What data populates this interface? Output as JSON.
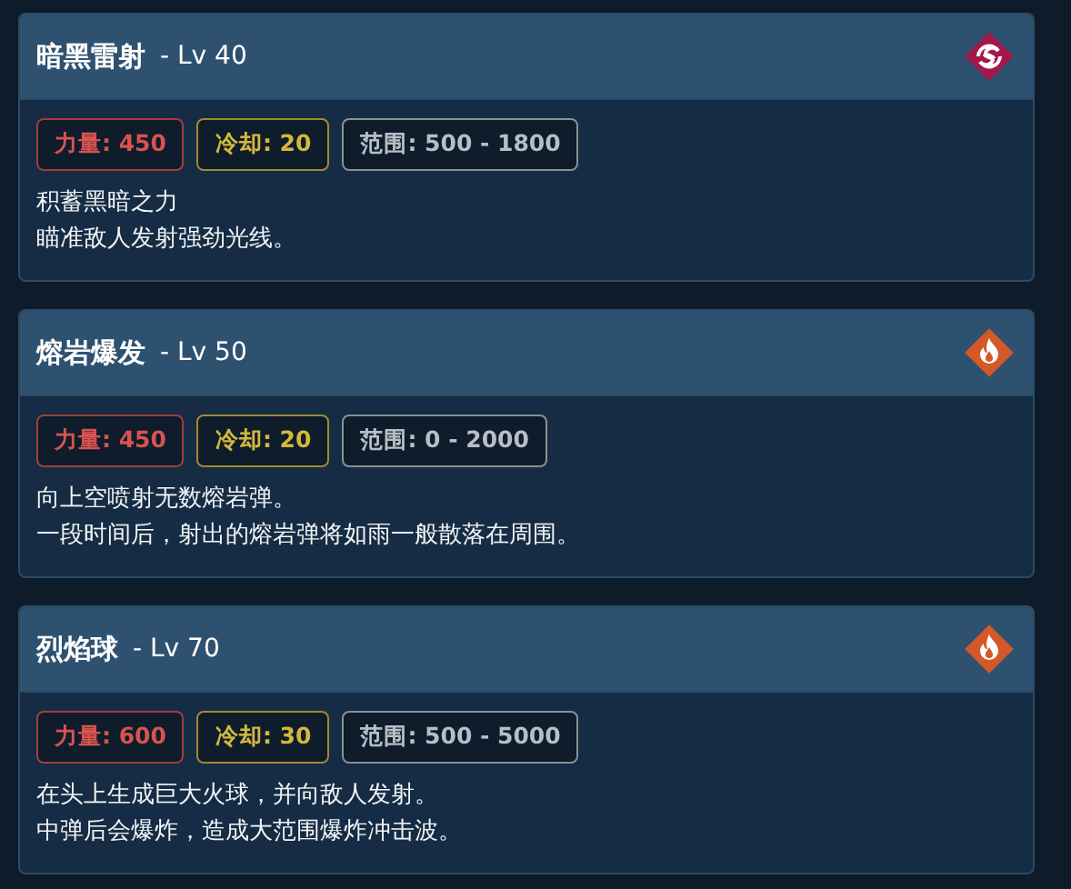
{
  "skills": [
    {
      "name": "暗黑雷射",
      "level": "- Lv 40",
      "kind": "dark",
      "stats": [
        {
          "kind": "power",
          "text": "力量: 450"
        },
        {
          "kind": "cooldown",
          "text": "冷却: 20"
        },
        {
          "kind": "range",
          "text": "范围: 500 - 1800"
        }
      ],
      "description": [
        "积蓄黑暗之力",
        "瞄准敌人发射强劲光线。"
      ]
    },
    {
      "name": "熔岩爆发",
      "level": "- Lv 50",
      "kind": "fire",
      "stats": [
        {
          "kind": "power",
          "text": "力量: 450"
        },
        {
          "kind": "cooldown",
          "text": "冷却: 20"
        },
        {
          "kind": "range",
          "text": "范围: 0 - 2000"
        }
      ],
      "description": [
        "向上空喷射无数熔岩弹。",
        "一段时间后，射出的熔岩弹将如雨一般散落在周围。"
      ]
    },
    {
      "name": "烈焰球",
      "level": "- Lv 70",
      "kind": "fire",
      "stats": [
        {
          "kind": "power",
          "text": "力量: 600"
        },
        {
          "kind": "cooldown",
          "text": "冷却: 30"
        },
        {
          "kind": "range",
          "text": "范围: 500 - 5000"
        }
      ],
      "description": [
        "在头上生成巨大火球，并向敌人发射。",
        "中弹后会爆炸，造成大范围爆炸冲击波。"
      ]
    }
  ]
}
